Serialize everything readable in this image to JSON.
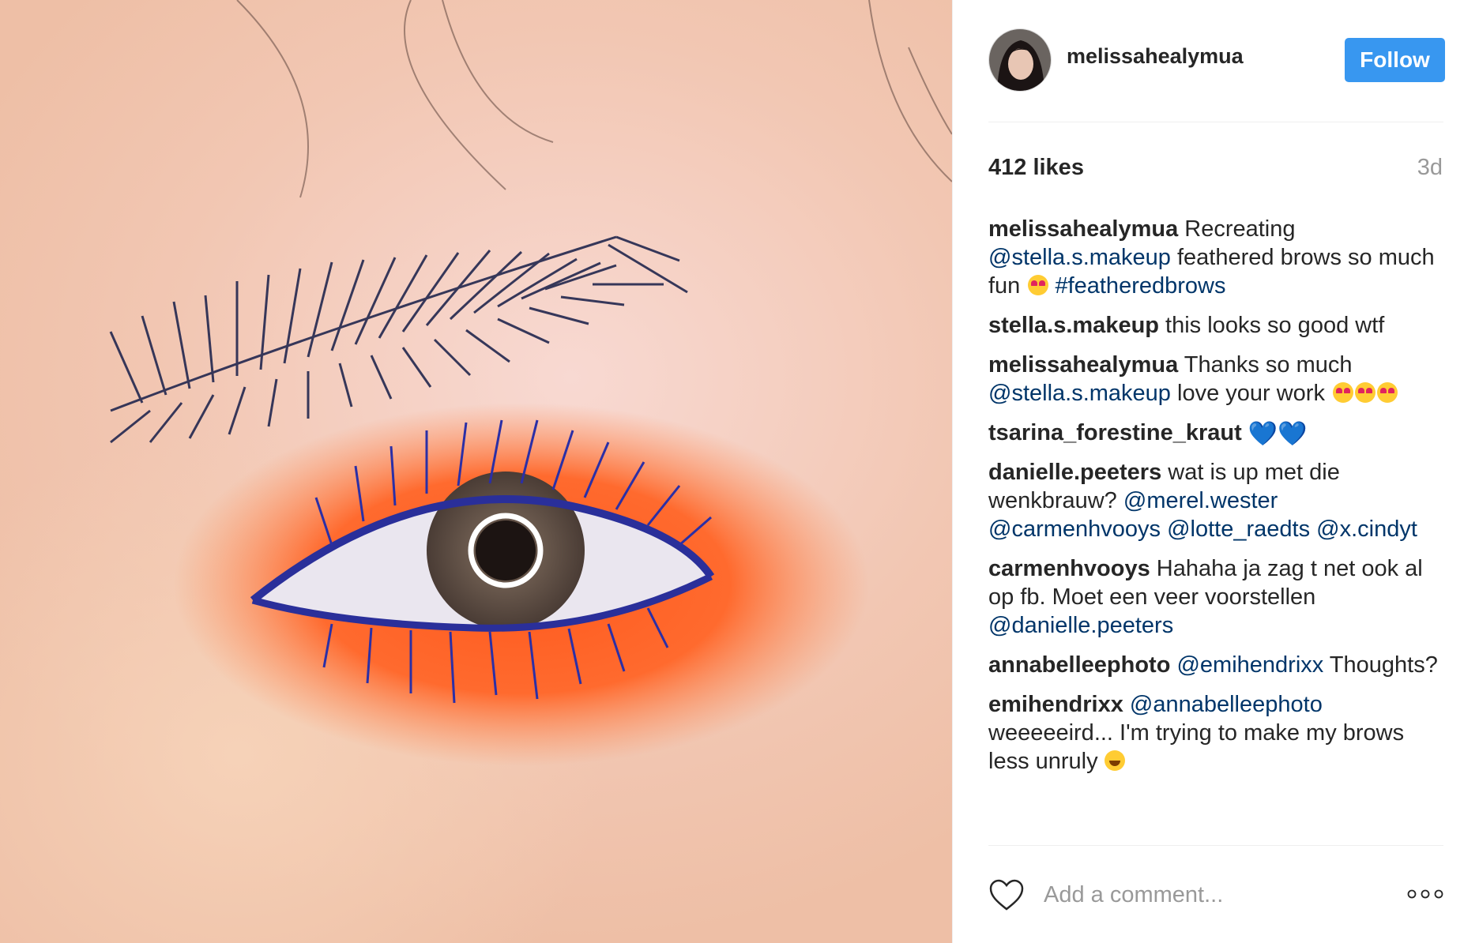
{
  "post": {
    "username": "melissahealymua",
    "follow_label": "Follow",
    "likes": "412 likes",
    "age": "3d",
    "comment_placeholder": "Add a comment...",
    "colors": {
      "accent": "#3897f0",
      "mention": "#003569",
      "muted": "#999999"
    }
  },
  "comments": [
    {
      "user": "melissahealymua",
      "parts": [
        {
          "t": " Recreating "
        },
        {
          "m": "@stella.s.makeup"
        },
        {
          "t": " feathered brows so much fun "
        },
        {
          "e": "heart-eyes"
        },
        {
          "t": " "
        },
        {
          "m": "#featheredbrows"
        }
      ]
    },
    {
      "user": "stella.s.makeup",
      "parts": [
        {
          "t": " this looks so good wtf"
        }
      ]
    },
    {
      "user": "melissahealymua",
      "parts": [
        {
          "t": " Thanks so much "
        },
        {
          "m": "@stella.s.makeup"
        },
        {
          "t": " love your work "
        },
        {
          "e": "heart-eyes"
        },
        {
          "e": "heart-eyes"
        },
        {
          "e": "heart-eyes"
        }
      ]
    },
    {
      "user": "tsarina_forestine_kraut",
      "parts": [
        {
          "t": " "
        },
        {
          "h": "💙💙"
        }
      ]
    },
    {
      "user": "danielle.peeters",
      "parts": [
        {
          "t": " wat is up met die wenkbrauw? "
        },
        {
          "m": "@merel.wester"
        },
        {
          "t": " "
        },
        {
          "m": "@carmenhvooys"
        },
        {
          "t": " "
        },
        {
          "m": "@lotte_raedts"
        },
        {
          "t": " "
        },
        {
          "m": "@x.cindyt"
        }
      ]
    },
    {
      "user": "carmenhvooys",
      "parts": [
        {
          "t": " Hahaha ja zag t net ook al op fb. Moet een veer voorstellen "
        },
        {
          "m": "@danielle.peeters"
        }
      ]
    },
    {
      "user": "annabelleephoto",
      "parts": [
        {
          "t": " "
        },
        {
          "m": "@emihendrixx"
        },
        {
          "t": " Thoughts?"
        }
      ]
    },
    {
      "user": "emihendrixx",
      "parts": [
        {
          "t": " "
        },
        {
          "m": "@annabelleephoto"
        },
        {
          "t": " weeeeeird... I'm trying to make my brows less unruly "
        },
        {
          "e": "laugh"
        }
      ]
    }
  ]
}
